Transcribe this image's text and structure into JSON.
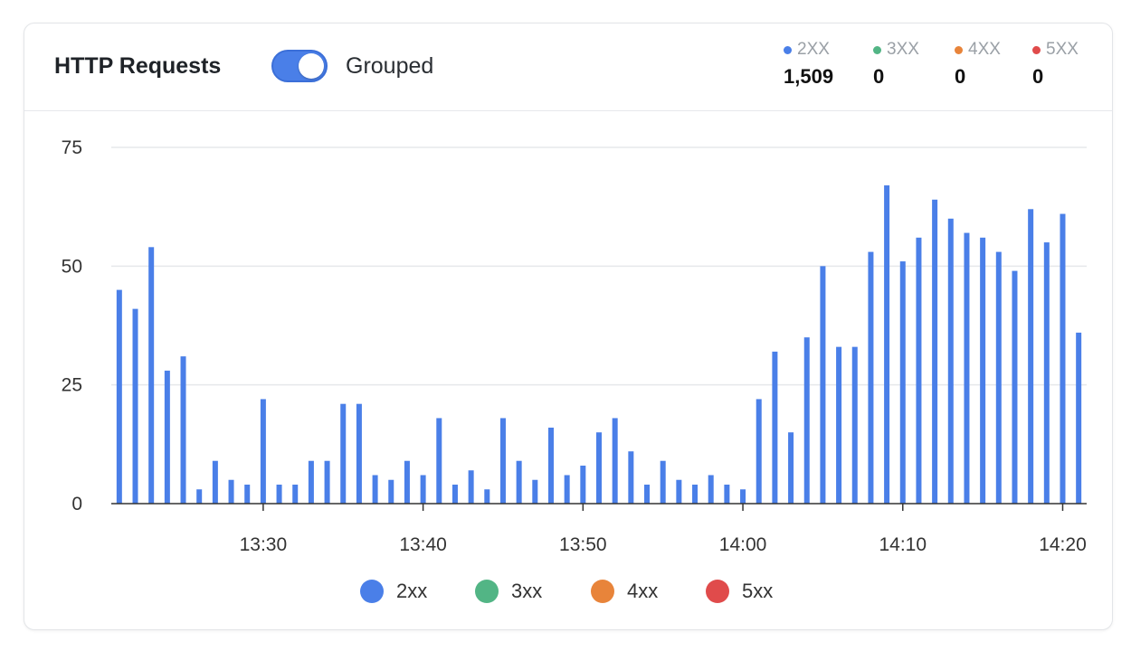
{
  "header": {
    "title": "HTTP Requests",
    "toggle_label": "Grouped",
    "toggle_on": true
  },
  "stats": [
    {
      "label": "2XX",
      "value": "1,509",
      "color": "#4a7fe8"
    },
    {
      "label": "3XX",
      "value": "0",
      "color": "#52b585"
    },
    {
      "label": "4XX",
      "value": "0",
      "color": "#e8843a"
    },
    {
      "label": "5XX",
      "value": "0",
      "color": "#e04b4b"
    }
  ],
  "legend": [
    {
      "label": "2xx",
      "color": "#4a7fe8"
    },
    {
      "label": "3xx",
      "color": "#52b585"
    },
    {
      "label": "4xx",
      "color": "#e8843a"
    },
    {
      "label": "5xx",
      "color": "#e04b4b"
    }
  ],
  "chart_data": {
    "type": "bar",
    "ylim": [
      0,
      75
    ],
    "yticks": [
      0,
      25,
      50,
      75
    ],
    "xticks": [
      "13:30",
      "13:40",
      "13:50",
      "14:00",
      "14:10",
      "14:20"
    ],
    "grid": true,
    "legend_position": "bottom",
    "series": [
      {
        "name": "2xx",
        "color": "#4a7fe8",
        "x_start": "13:21",
        "x_step_minutes": 1,
        "values": [
          45,
          41,
          54,
          28,
          31,
          3,
          9,
          5,
          4,
          22,
          4,
          4,
          9,
          9,
          21,
          21,
          6,
          5,
          9,
          6,
          18,
          4,
          7,
          3,
          18,
          9,
          5,
          16,
          6,
          8,
          15,
          18,
          11,
          4,
          9,
          5,
          4,
          6,
          4,
          3,
          22,
          32,
          15,
          35,
          50,
          33,
          33,
          53,
          67,
          51,
          56,
          64,
          60,
          57,
          56,
          53,
          49,
          62,
          55,
          61,
          36
        ]
      }
    ]
  }
}
